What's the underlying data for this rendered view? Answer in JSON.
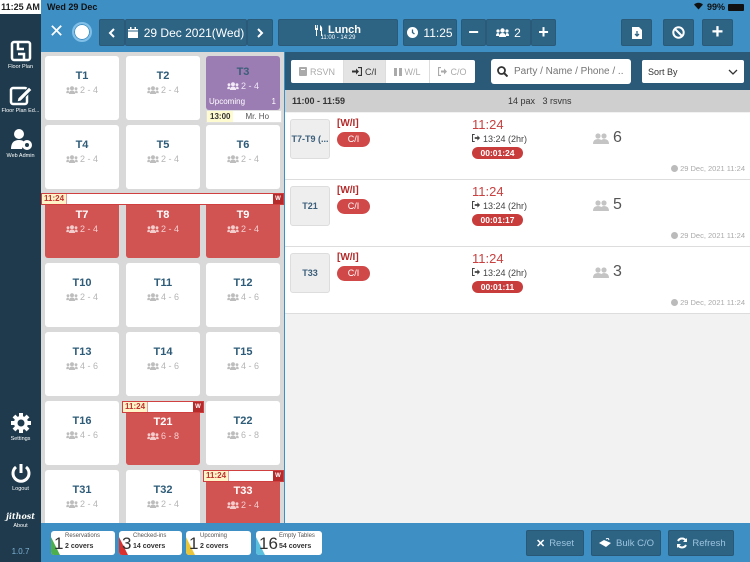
{
  "status_bar": {
    "time": "11:25 AM",
    "date": "Wed 29 Dec",
    "battery": "99%"
  },
  "sidebar": {
    "items": [
      {
        "label": "Floor Plan",
        "icon": "floor-plan-icon"
      },
      {
        "label": "Floor Plan Ed...",
        "icon": "edit-icon"
      },
      {
        "label": "Web Admin",
        "icon": "user-gear-icon"
      },
      {
        "label": "Settings",
        "icon": "gear-icon"
      },
      {
        "label": "Logout",
        "icon": "power-icon"
      },
      {
        "label": "About",
        "icon": "logo-icon",
        "logo_text": "jithost"
      }
    ],
    "version": "1.0.7"
  },
  "topbar": {
    "date": "29 Dec 2021(Wed)",
    "meal": "Lunch",
    "meal_hours": "11:00 - 14:29",
    "time": "11:25",
    "party_size": "2"
  },
  "floor": {
    "tables": [
      {
        "name": "T1",
        "capacity": "2 - 4",
        "state": "empty"
      },
      {
        "name": "T2",
        "capacity": "2 - 4",
        "state": "empty"
      },
      {
        "name": "T3",
        "capacity": "2 - 4",
        "state": "upcoming",
        "upcoming_label": "Upcoming",
        "upcoming_count": "1",
        "resv_time": "13:00",
        "resv_name": "Mr. Ho"
      },
      {
        "name": "T4",
        "capacity": "2 - 4",
        "state": "empty"
      },
      {
        "name": "T5",
        "capacity": "2 - 4",
        "state": "empty"
      },
      {
        "name": "T6",
        "capacity": "2 - 4",
        "state": "empty"
      },
      {
        "name": "T7",
        "capacity": "2 - 4",
        "state": "occupied"
      },
      {
        "name": "T8",
        "capacity": "2 - 4",
        "state": "occupied"
      },
      {
        "name": "T9",
        "capacity": "2 - 4",
        "state": "occupied"
      },
      {
        "name": "T10",
        "capacity": "2 - 4",
        "state": "empty"
      },
      {
        "name": "T11",
        "capacity": "4 - 6",
        "state": "empty"
      },
      {
        "name": "T12",
        "capacity": "4 - 6",
        "state": "empty"
      },
      {
        "name": "T13",
        "capacity": "4 - 6",
        "state": "empty"
      },
      {
        "name": "T14",
        "capacity": "4 - 6",
        "state": "empty"
      },
      {
        "name": "T15",
        "capacity": "4 - 6",
        "state": "empty"
      },
      {
        "name": "T16",
        "capacity": "4 - 6",
        "state": "empty"
      },
      {
        "name": "T21",
        "capacity": "6 - 8",
        "state": "occupied"
      },
      {
        "name": "T22",
        "capacity": "6 - 8",
        "state": "empty"
      },
      {
        "name": "T31",
        "capacity": "2 - 4",
        "state": "empty"
      },
      {
        "name": "T32",
        "capacity": "2 - 4",
        "state": "empty"
      },
      {
        "name": "T33",
        "capacity": "2 - 4",
        "state": "occupied"
      }
    ],
    "walkins": [
      {
        "time": "11:24",
        "badge": "W",
        "tables": "T7-T9"
      },
      {
        "time": "11:24",
        "badge": "W",
        "tables": "T21"
      },
      {
        "time": "11:24",
        "badge": "W",
        "tables": "T33"
      }
    ]
  },
  "list": {
    "filters": [
      {
        "label": "RSVN",
        "icon": "book-icon",
        "active": false
      },
      {
        "label": "C/I",
        "icon": "sign-in-icon",
        "active": true
      },
      {
        "label": "W/L",
        "icon": "pause-icon",
        "active": false
      },
      {
        "label": "C/O",
        "icon": "sign-out-icon",
        "active": false
      }
    ],
    "search_placeholder": "Party / Name / Phone / ...",
    "sort_label": "Sort By",
    "group": {
      "time_range": "11:00 - 11:59",
      "summary": "14 pax   3 rsvns"
    },
    "entries": [
      {
        "table": "T7-T9 (...",
        "type": "[W/I]",
        "status": "C/I",
        "time": "11:24",
        "checkout": "13:24 (2hr)",
        "timer": "00:01:24",
        "pax": "6",
        "created": "29 Dec, 2021 11:24"
      },
      {
        "table": "T21",
        "type": "[W/I]",
        "status": "C/I",
        "time": "11:24",
        "checkout": "13:24 (2hr)",
        "timer": "00:01:17",
        "pax": "5",
        "created": "29 Dec, 2021 11:24"
      },
      {
        "table": "T33",
        "type": "[W/I]",
        "status": "C/I",
        "time": "11:24",
        "checkout": "13:24 (2hr)",
        "timer": "00:01:11",
        "pax": "3",
        "created": "29 Dec, 2021 11:24"
      }
    ]
  },
  "stats": [
    {
      "count": "1",
      "label": "Reservations",
      "covers": "2 covers",
      "color": "#4cae4c"
    },
    {
      "count": "3",
      "label": "Checked-ins",
      "covers": "14 covers",
      "color": "#d9312e"
    },
    {
      "count": "1",
      "label": "Upcoming",
      "covers": "2 covers",
      "color": "#e8c53a"
    },
    {
      "count": "16",
      "label": "Empty Tables",
      "covers": "54 covers",
      "color": "#5bc0de"
    }
  ],
  "actions": {
    "reset": "Reset",
    "bulk_checkout": "Bulk C/O",
    "refresh": "Refresh"
  }
}
